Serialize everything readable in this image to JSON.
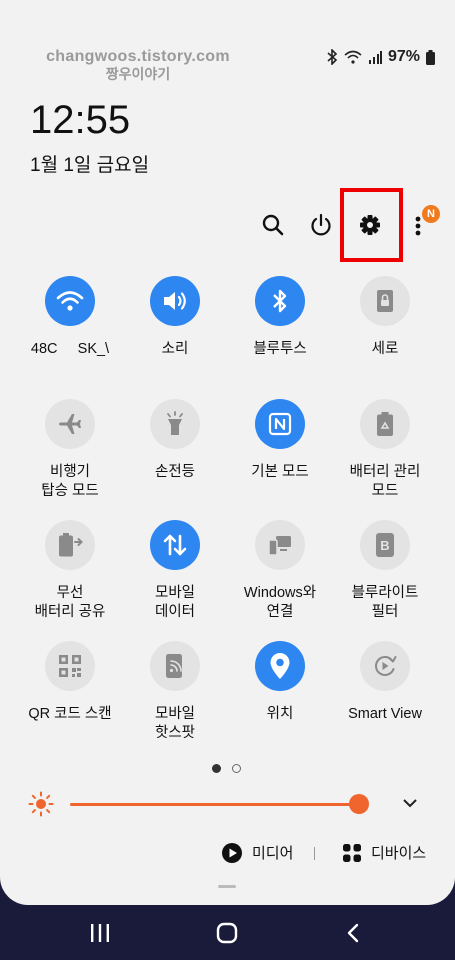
{
  "watermark": {
    "line1": "changwoos.tistory.com",
    "line2": "짱우이야기"
  },
  "status": {
    "battery": "97%"
  },
  "header": {
    "time": "12:55",
    "date": "1월 1일 금요일"
  },
  "toolbar": {
    "badge": "N"
  },
  "tiles": [
    {
      "label": "48C     SK_\\",
      "icon": "wifi-icon",
      "on": true
    },
    {
      "label": "소리",
      "icon": "sound-icon",
      "on": true
    },
    {
      "label": "블루투스",
      "icon": "bluetooth-icon",
      "on": true
    },
    {
      "label": "세로",
      "icon": "portrait-lock-icon",
      "on": false
    },
    {
      "label": "비행기\n탑승 모드",
      "icon": "airplane-icon",
      "on": false
    },
    {
      "label": "손전등",
      "icon": "flashlight-icon",
      "on": false
    },
    {
      "label": "기본 모드",
      "icon": "nfc-icon",
      "on": true
    },
    {
      "label": "배터리 관리\n모드",
      "icon": "battery-recycle-icon",
      "on": false
    },
    {
      "label": "무선\n배터리 공유",
      "icon": "wireless-battery-share-icon",
      "on": false
    },
    {
      "label": "모바일\n데이터",
      "icon": "mobile-data-icon",
      "on": true
    },
    {
      "label": "Windows와\n연결",
      "icon": "link-windows-icon",
      "on": false
    },
    {
      "label": "블루라이트\n필터",
      "icon": "blue-light-filter-icon",
      "on": false
    },
    {
      "label": "QR 코드 스캔",
      "icon": "qr-code-icon",
      "on": false
    },
    {
      "label": "모바일\n핫스팟",
      "icon": "hotspot-icon",
      "on": false
    },
    {
      "label": "위치",
      "icon": "location-icon",
      "on": true
    },
    {
      "label": "Smart View",
      "icon": "smart-view-icon",
      "on": false
    }
  ],
  "brightness": {
    "level": 0.97
  },
  "bottom": {
    "media_label": "미디어",
    "devices_label": "디바이스"
  },
  "colors": {
    "accent": "#2e86f0",
    "brightness": "#f0642e",
    "highlight": "#ee0000"
  }
}
